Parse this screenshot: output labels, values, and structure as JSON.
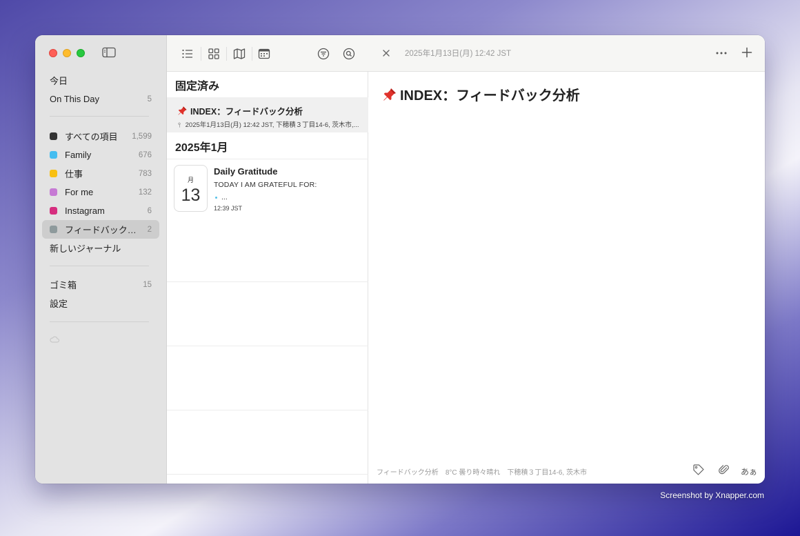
{
  "sidebar": {
    "top_items": [
      {
        "label": "今日",
        "count": ""
      },
      {
        "label": "On This Day",
        "count": "5"
      }
    ],
    "journals": [
      {
        "label": "すべての項目",
        "count": "1,599",
        "color": "#333333"
      },
      {
        "label": "Family",
        "count": "676",
        "color": "#45bdf0"
      },
      {
        "label": "仕事",
        "count": "783",
        "color": "#f8c013"
      },
      {
        "label": "For me",
        "count": "132",
        "color": "#c67ad4"
      },
      {
        "label": "Instagram",
        "count": "6",
        "color": "#d62e7f"
      },
      {
        "label": "フィードバック…",
        "count": "2",
        "color": "#8e9a9c"
      }
    ],
    "new_journal": "新しいジャーナル",
    "trash": {
      "label": "ゴミ箱",
      "count": "15"
    },
    "settings": "設定"
  },
  "list": {
    "pinned_header": "固定済み",
    "pinned_entry": {
      "title": "INDEX：フィードバック分析",
      "meta": "2025年1月13日(月) 12:42 JST,  下穂積３丁目14-6, 茨木市,..."
    },
    "month_header": "2025年1月",
    "entry": {
      "weekday": "月",
      "day": "13",
      "title": "Daily Gratitude",
      "body": "TODAY I AM GRATEFUL FOR:",
      "bullet": "...",
      "time": "12:39 JST"
    }
  },
  "detail": {
    "date": "2025年1月13日(月) 12:42 JST",
    "title": "INDEX：フィードバック分析",
    "footer": {
      "journal": "フィードバック分析",
      "weather": "8°C 曇り時々晴れ",
      "location": "下穂積３丁目14-6, 茨木市"
    },
    "font_button": "あぁ"
  },
  "watermark": "Screenshot by Xnapper.com"
}
